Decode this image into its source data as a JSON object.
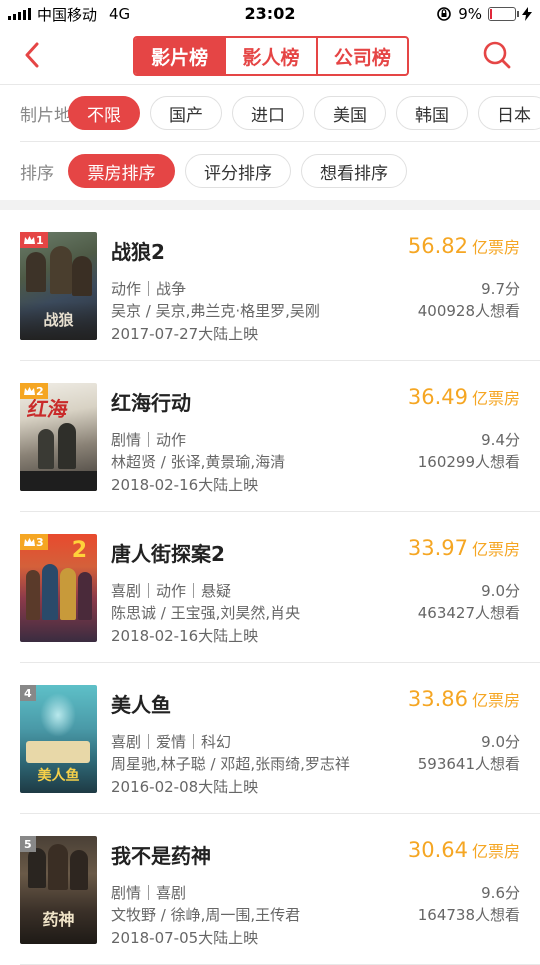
{
  "status_bar": {
    "carrier": "中国移动",
    "network": "4G",
    "time": "23:02",
    "battery": "9%",
    "battery_level": 0.09
  },
  "nav": {
    "tabs": [
      "影片榜",
      "影人榜",
      "公司榜"
    ],
    "active_tab": 0
  },
  "filters": {
    "region_label": "制片地",
    "regions": [
      "不限",
      "国产",
      "进口",
      "美国",
      "韩国",
      "日本"
    ],
    "region_active": 0,
    "sort_label": "排序",
    "sorts": [
      "票房排序",
      "评分排序",
      "想看排序"
    ],
    "sort_active": 0
  },
  "colors": {
    "accent": "#e54545",
    "box_office": "#f5a623",
    "rank_top": "#e54545",
    "rank_gold": "#f5a623",
    "rank_other": "#888888"
  },
  "unit_label": "亿票房",
  "movies": [
    {
      "rank": "1",
      "crown": true,
      "title": "战狼2",
      "genres": "动作｜战争",
      "cast": "吴京 / 吴京,弗兰克·格里罗,吴刚",
      "release": "2017-07-27大陆上映",
      "box": "56.82",
      "score": "9.7分",
      "want": "400928人想看",
      "poster_text": "战狼"
    },
    {
      "rank": "2",
      "crown": true,
      "title": "红海行动",
      "genres": "剧情｜动作",
      "cast": "林超贤 / 张译,黄景瑜,海清",
      "release": "2018-02-16大陆上映",
      "box": "36.49",
      "score": "9.4分",
      "want": "160299人想看",
      "poster_text": "红海"
    },
    {
      "rank": "3",
      "crown": true,
      "title": "唐人街探案2",
      "genres": "喜剧｜动作｜悬疑",
      "cast": "陈思诚 / 王宝强,刘昊然,肖央",
      "release": "2018-02-16大陆上映",
      "box": "33.97",
      "score": "9.0分",
      "want": "463427人想看",
      "poster_text": "2"
    },
    {
      "rank": "4",
      "crown": false,
      "title": "美人鱼",
      "genres": "喜剧｜爱情｜科幻",
      "cast": "周星驰,林子聪 / 邓超,张雨绮,罗志祥",
      "release": "2016-02-08大陆上映",
      "box": "33.86",
      "score": "9.0分",
      "want": "593641人想看",
      "poster_text": "美人鱼"
    },
    {
      "rank": "5",
      "crown": false,
      "title": "我不是药神",
      "genres": "剧情｜喜剧",
      "cast": "文牧野 / 徐峥,周一围,王传君",
      "release": "2018-07-05大陆上映",
      "box": "30.64",
      "score": "9.6分",
      "want": "164738人想看",
      "poster_text": "药神"
    }
  ]
}
